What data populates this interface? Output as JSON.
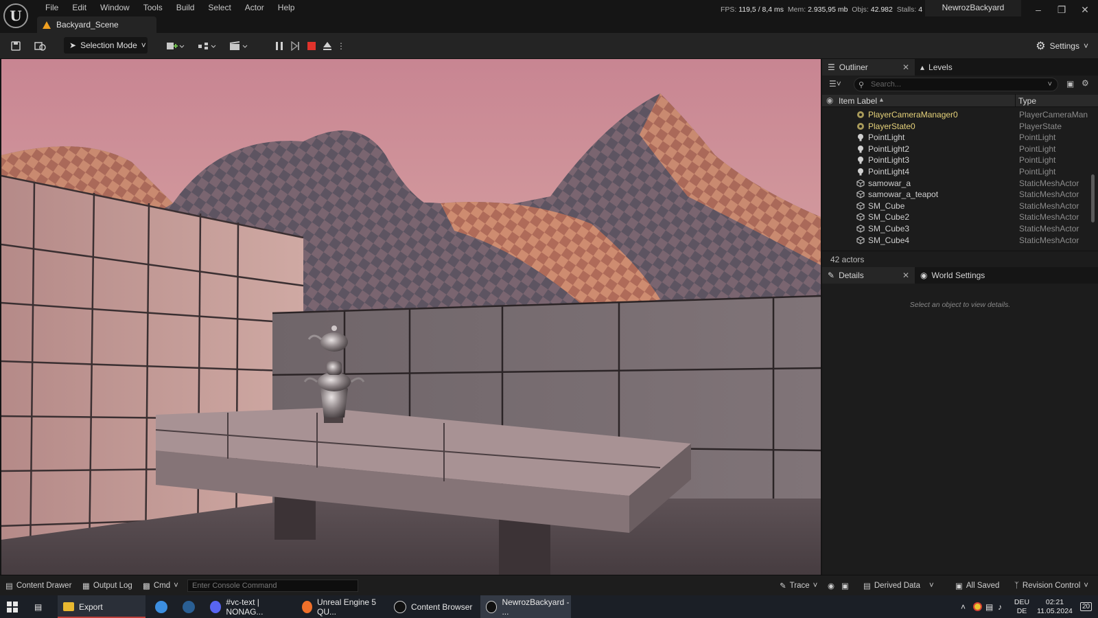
{
  "app": {
    "logo": "U",
    "project_name": "NewrozBackyard"
  },
  "menu": [
    "File",
    "Edit",
    "Window",
    "Tools",
    "Build",
    "Select",
    "Actor",
    "Help"
  ],
  "tab": {
    "label": "Backyard_Scene"
  },
  "stats": {
    "fps_label": "FPS:",
    "fps": "119,5",
    "ms": "/ 8,4 ms",
    "mem_label": "Mem:",
    "mem": "2.935,95 mb",
    "objs_label": "Objs:",
    "objs": "42.982",
    "stalls_label": "Stalls:",
    "stalls": "4"
  },
  "toolbar": {
    "selection_mode": "Selection Mode",
    "settings": "Settings"
  },
  "outliner": {
    "tab": "Outliner",
    "levels_tab": "Levels",
    "search_placeholder": "Search...",
    "col_label": "Item Label",
    "col_type": "Type",
    "items": [
      {
        "label": "PlayerCameraManager0",
        "type": "PlayerCameraManager",
        "icon": "actor-icon",
        "gold": true
      },
      {
        "label": "PlayerState0",
        "type": "PlayerState",
        "icon": "actor-icon",
        "gold": true
      },
      {
        "label": "PointLight",
        "type": "PointLight",
        "icon": "light-bulb-icon"
      },
      {
        "label": "PointLight2",
        "type": "PointLight",
        "icon": "light-bulb-icon"
      },
      {
        "label": "PointLight3",
        "type": "PointLight",
        "icon": "light-bulb-icon"
      },
      {
        "label": "PointLight4",
        "type": "PointLight",
        "icon": "light-bulb-icon"
      },
      {
        "label": "samowar_a",
        "type": "StaticMeshActor",
        "icon": "static-mesh-icon"
      },
      {
        "label": "samowar_a_teapot",
        "type": "StaticMeshActor",
        "icon": "static-mesh-icon"
      },
      {
        "label": "SM_Cube",
        "type": "StaticMeshActor",
        "icon": "static-mesh-icon"
      },
      {
        "label": "SM_Cube2",
        "type": "StaticMeshActor",
        "icon": "static-mesh-icon"
      },
      {
        "label": "SM_Cube3",
        "type": "StaticMeshActor",
        "icon": "static-mesh-icon"
      },
      {
        "label": "SM_Cube4",
        "type": "StaticMeshActor",
        "icon": "static-mesh-icon"
      }
    ],
    "count": "42 actors"
  },
  "details": {
    "tab": "Details",
    "world_tab": "World Settings",
    "empty": "Select an object to view details."
  },
  "statusbar": {
    "content_drawer": "Content Drawer",
    "output_log": "Output Log",
    "cmd": "Cmd",
    "console_placeholder": "Enter Console Command",
    "trace": "Trace",
    "derived_data": "Derived Data",
    "all_saved": "All Saved",
    "revision_control": "Revision Control"
  },
  "taskbar": {
    "export": "Export",
    "discord": "#vc-text | NONAG...",
    "firefox": "Unreal Engine 5 QU...",
    "content_browser": "Content Browser",
    "unreal": "NewrozBackyard - ...",
    "lang1": "DEU",
    "lang2": "DE",
    "time": "02:21",
    "date": "11.05.2024",
    "notif": "20"
  }
}
